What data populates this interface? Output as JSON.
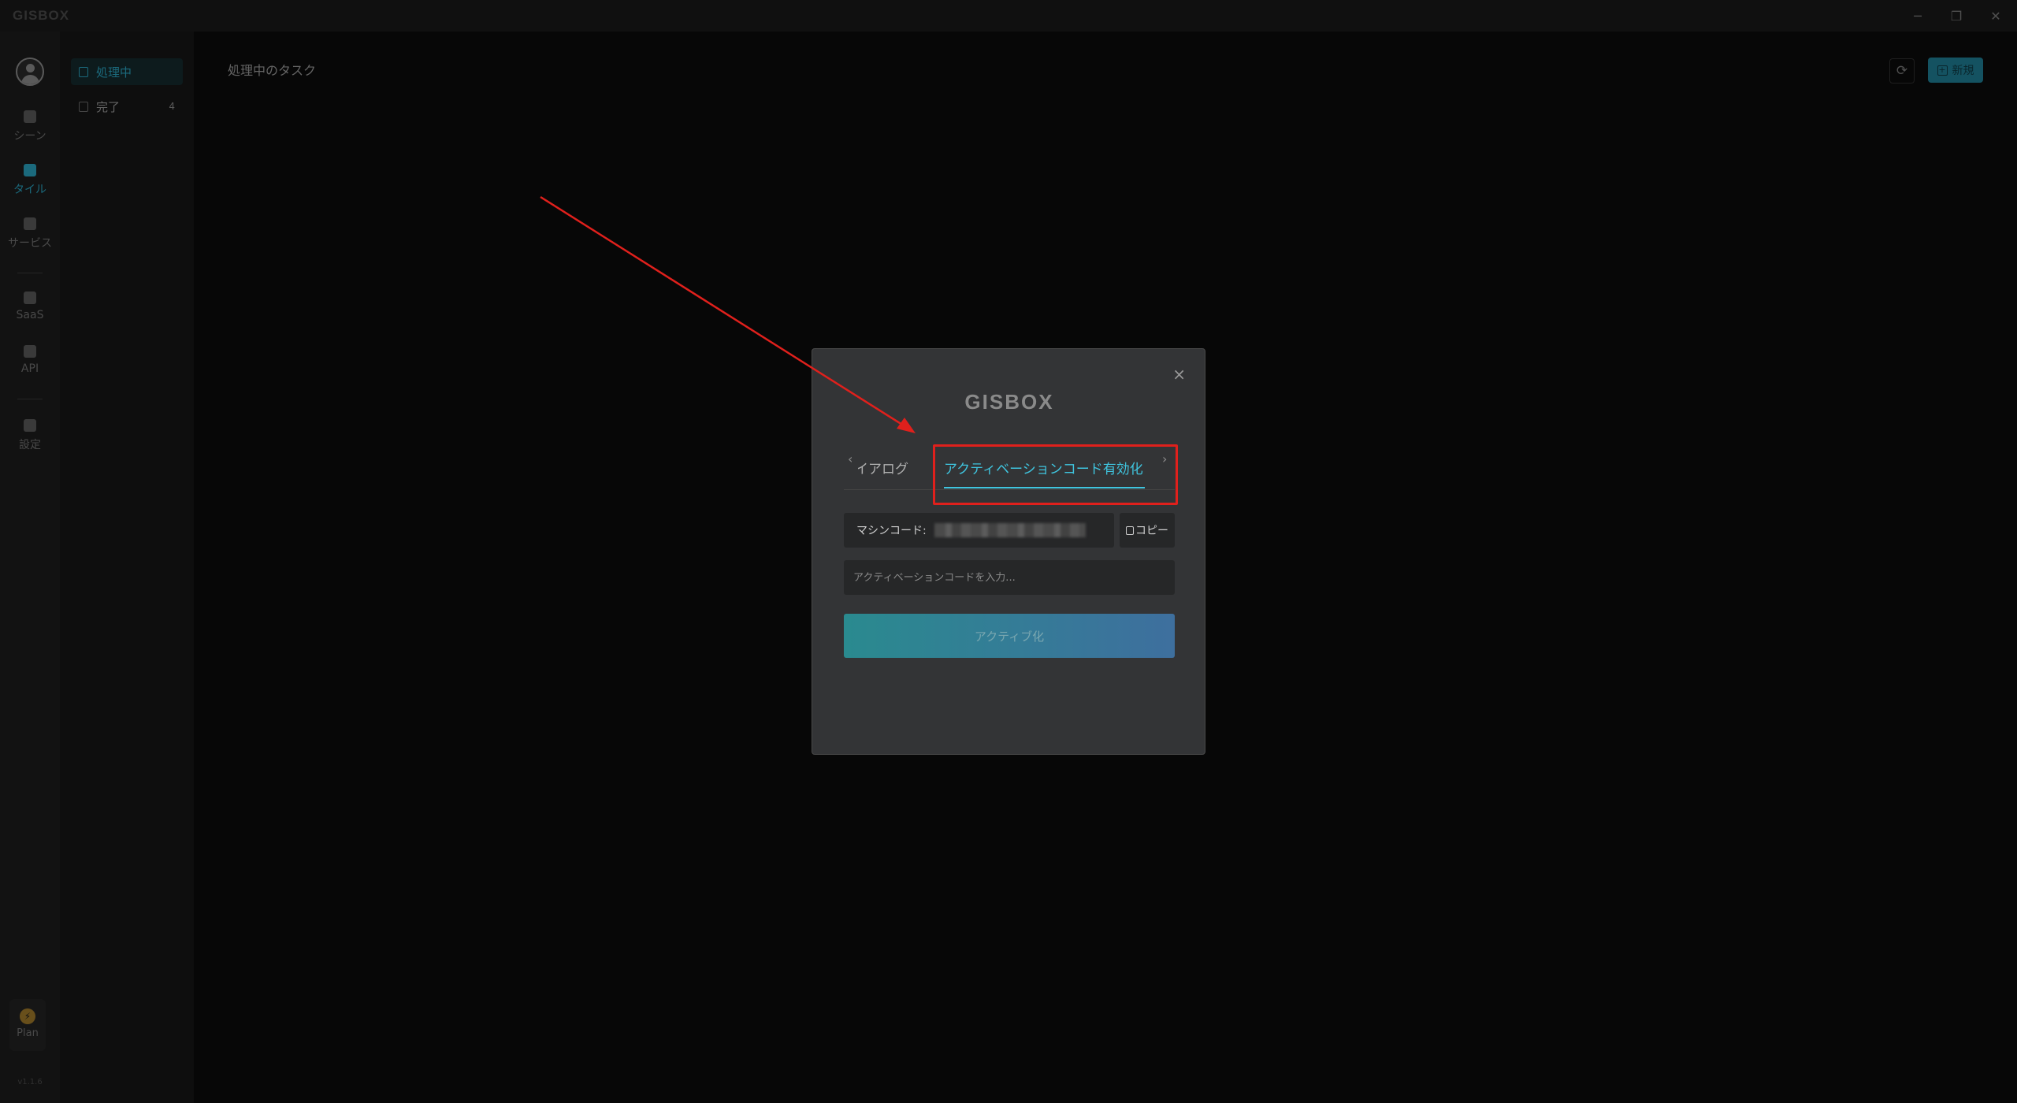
{
  "app": {
    "logo": "GISBOX"
  },
  "window_controls": {
    "minimize": "─",
    "restore": "❐",
    "close": "✕"
  },
  "leftnav": {
    "items": [
      {
        "label": "シーン",
        "icon": "scene-icon",
        "active": false
      },
      {
        "label": "タイル",
        "icon": "tile-icon",
        "active": true
      },
      {
        "label": "サービス",
        "icon": "service-icon",
        "active": false
      },
      {
        "label": "SaaS",
        "icon": "saas-icon",
        "active": false
      },
      {
        "label": "API",
        "icon": "api-icon",
        "active": false
      },
      {
        "label": "設定",
        "icon": "settings-icon",
        "active": false
      }
    ],
    "plan_label": "Plan",
    "version": "v1.1.6"
  },
  "subnav": {
    "items": [
      {
        "label": "処理中",
        "count": "",
        "active": true
      },
      {
        "label": "完了",
        "count": "4",
        "active": false
      }
    ]
  },
  "main": {
    "title": "処理中のタスク",
    "refresh_icon": "⟳",
    "new_label": "新規"
  },
  "dialog": {
    "logo": "GISBOX",
    "close": "×",
    "tab_prev_arrow": "‹",
    "tab_next_arrow": "›",
    "tab_partial": "ダイアログ",
    "tab_active": "アクティベーションコード有効化",
    "machine_code_label": "マシンコード:",
    "copy_label": "コピー",
    "activation_placeholder": "アクティベーションコードを入力...",
    "activate_label": "アクティブ化"
  },
  "colors": {
    "accent": "#2aa3c0",
    "annotation": "#e0201c"
  }
}
